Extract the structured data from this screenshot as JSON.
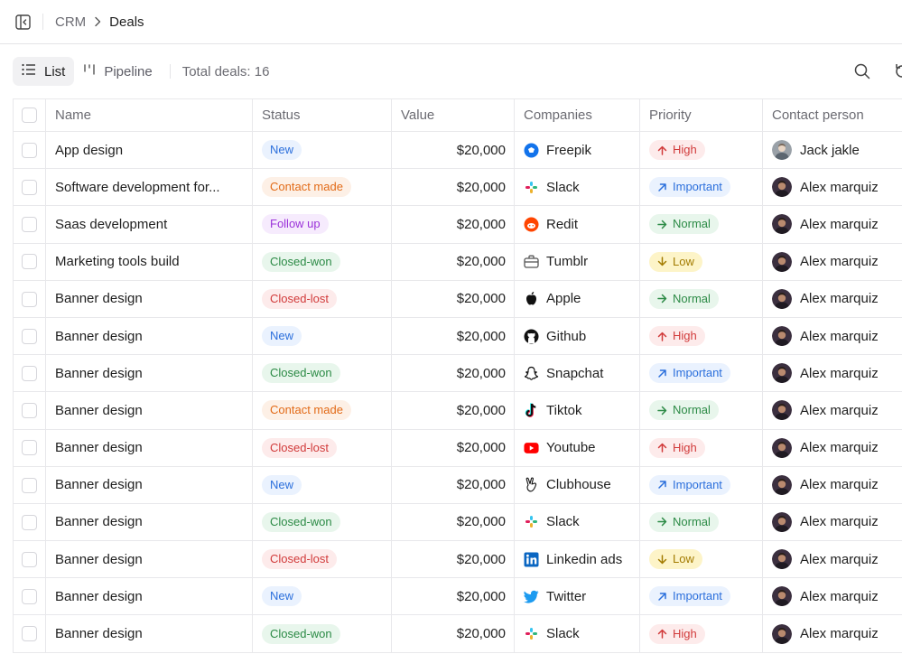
{
  "breadcrumb": {
    "root": "CRM",
    "current": "Deals"
  },
  "toolbar": {
    "list_label": "List",
    "pipeline_label": "Pipeline",
    "total": "Total deals: 16"
  },
  "table": {
    "columns": [
      "Name",
      "Status",
      "Value",
      "Companies",
      "Priority",
      "Contact person"
    ],
    "rows": [
      {
        "name": "App design",
        "status": "New",
        "value": "$20,000",
        "company": "Freepik",
        "priority": "High",
        "contact": "Jack jakle"
      },
      {
        "name": "Software development for...",
        "status": "Contact made",
        "value": "$20,000",
        "company": "Slack",
        "priority": "Important",
        "contact": "Alex marquiz"
      },
      {
        "name": "Saas development",
        "status": "Follow up",
        "value": "$20,000",
        "company": "Redit",
        "priority": "Normal",
        "contact": "Alex marquiz"
      },
      {
        "name": "Marketing tools build",
        "status": "Closed-won",
        "value": "$20,000",
        "company": "Tumblr",
        "priority": "Low",
        "contact": "Alex marquiz"
      },
      {
        "name": "Banner design",
        "status": "Closed-lost",
        "value": "$20,000",
        "company": "Apple",
        "priority": "Normal",
        "contact": "Alex marquiz"
      },
      {
        "name": "Banner design",
        "status": "New",
        "value": "$20,000",
        "company": "Github",
        "priority": "High",
        "contact": "Alex marquiz"
      },
      {
        "name": "Banner design",
        "status": "Closed-won",
        "value": "$20,000",
        "company": "Snapchat",
        "priority": "Important",
        "contact": "Alex marquiz"
      },
      {
        "name": "Banner design",
        "status": "Contact made",
        "value": "$20,000",
        "company": "Tiktok",
        "priority": "Normal",
        "contact": "Alex marquiz"
      },
      {
        "name": "Banner design",
        "status": "Closed-lost",
        "value": "$20,000",
        "company": "Youtube",
        "priority": "High",
        "contact": "Alex marquiz"
      },
      {
        "name": "Banner design",
        "status": "New",
        "value": "$20,000",
        "company": "Clubhouse",
        "priority": "Important",
        "contact": "Alex marquiz"
      },
      {
        "name": "Banner design",
        "status": "Closed-won",
        "value": "$20,000",
        "company": "Slack",
        "priority": "Normal",
        "contact": "Alex marquiz"
      },
      {
        "name": "Banner design",
        "status": "Closed-lost",
        "value": "$20,000",
        "company": "Linkedin ads",
        "priority": "Low",
        "contact": "Alex marquiz"
      },
      {
        "name": "Banner design",
        "status": "New",
        "value": "$20,000",
        "company": "Twitter",
        "priority": "Important",
        "contact": "Alex marquiz"
      },
      {
        "name": "Banner design",
        "status": "Closed-won",
        "value": "$20,000",
        "company": "Slack",
        "priority": "High",
        "contact": "Alex marquiz"
      }
    ]
  },
  "icons": {
    "sidebar_toggle": "sidebar-toggle-icon",
    "list": "list-icon",
    "pipeline": "pipeline-icon",
    "search": "search-icon",
    "refresh": "refresh-icon",
    "breadcrumb_separator": "chevron-right-icon"
  },
  "colors": {
    "status": {
      "New": "#2b6fdc",
      "Contact made": "#e26a17",
      "Follow up": "#9b32d9",
      "Closed-won": "#2b8a45",
      "Closed-lost": "#d13a3a"
    },
    "priority": {
      "High": "#d13a3a",
      "Important": "#2b6fdc",
      "Normal": "#2b8a45",
      "Low": "#a37b00"
    }
  }
}
